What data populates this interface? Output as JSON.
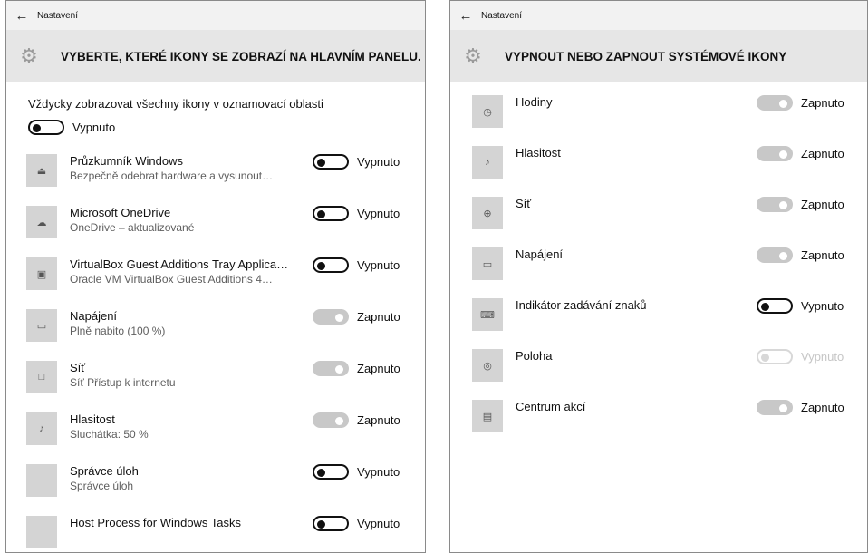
{
  "left": {
    "window_title": "Nastavení",
    "back_icon": "back-arrow-icon",
    "header_icon": "gear-icon",
    "header_title": "VYBERTE, KTERÉ IKONY SE ZOBRAZÍ NA HLAVNÍM PANELU.",
    "always_show": {
      "label": "Vždycky zobrazovat všechny ikony v oznamovací oblasti",
      "state": "Vypnuto",
      "on": false
    },
    "items": [
      {
        "name": "Průzkumník Windows",
        "sub": "Bezpečně odebrat hardware a vysunout…",
        "state": "Vypnuto",
        "on": false,
        "icon": "usb-eject-icon"
      },
      {
        "name": "Microsoft OneDrive",
        "sub": "OneDrive – aktualizované",
        "state": "Vypnuto",
        "on": false,
        "icon": "cloud-icon"
      },
      {
        "name": "VirtualBox Guest Additions Tray Applica…",
        "sub": "Oracle VM VirtualBox Guest Additions 4…",
        "state": "Vypnuto",
        "on": false,
        "icon": "virtualbox-icon"
      },
      {
        "name": "Napájení",
        "sub": "Plně nabito (100 %)",
        "state": "Zapnuto",
        "on": true,
        "icon": "battery-icon"
      },
      {
        "name": "Síť",
        "sub": "Síť Přístup k internetu",
        "state": "Zapnuto",
        "on": true,
        "icon": "network-icon"
      },
      {
        "name": "Hlasitost",
        "sub": "Sluchátka: 50 %",
        "state": "Zapnuto",
        "on": true,
        "icon": "volume-icon"
      },
      {
        "name": "Správce úloh",
        "sub": "Správce úloh",
        "state": "Vypnuto",
        "on": false,
        "icon": "blank-icon"
      },
      {
        "name": "Host Process for Windows Tasks",
        "sub": "",
        "state": "Vypnuto",
        "on": false,
        "icon": "blank-icon"
      }
    ]
  },
  "right": {
    "window_title": "Nastavení",
    "back_icon": "back-arrow-icon",
    "header_icon": "gear-icon",
    "header_title": "VYPNOUT NEBO ZAPNOUT SYSTÉMOVÉ IKONY",
    "items": [
      {
        "name": "Hodiny",
        "state": "Zapnuto",
        "on": true,
        "disabled": false,
        "icon": "clock-icon"
      },
      {
        "name": "Hlasitost",
        "state": "Zapnuto",
        "on": true,
        "disabled": false,
        "icon": "volume-icon"
      },
      {
        "name": "Síť",
        "state": "Zapnuto",
        "on": true,
        "disabled": false,
        "icon": "globe-icon"
      },
      {
        "name": "Napájení",
        "state": "Zapnuto",
        "on": true,
        "disabled": false,
        "icon": "battery-icon"
      },
      {
        "name": "Indikátor zadávání znaků",
        "state": "Vypnuto",
        "on": false,
        "disabled": false,
        "icon": "keyboard-icon"
      },
      {
        "name": "Poloha",
        "state": "Vypnuto",
        "on": false,
        "disabled": true,
        "icon": "location-icon"
      },
      {
        "name": "Centrum akcí",
        "state": "Zapnuto",
        "on": true,
        "disabled": false,
        "icon": "action-center-icon"
      }
    ]
  }
}
